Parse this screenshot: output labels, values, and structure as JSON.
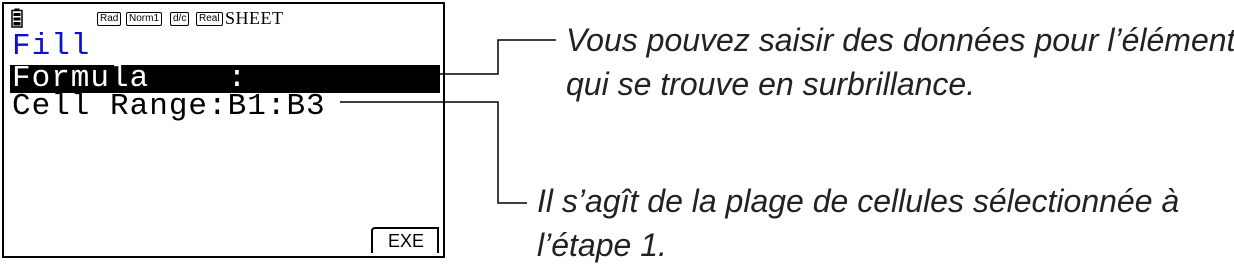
{
  "screen": {
    "status": {
      "badge_rad": "Rad",
      "badge_norm": "Norm1",
      "badge_dc": "d/c",
      "badge_real": "Real",
      "mode": "SHEET"
    },
    "title": "Fill",
    "formula_row": "Formula    :",
    "cell_range_row": "Cell Range:B1:B3",
    "softkey_exe": "EXE"
  },
  "annotations": {
    "highlighted_line1": "Vous pouvez saisir des données pour l’élément",
    "highlighted_line2": "qui se trouve en surbrillance.",
    "range_line1": "Il s’agît de la plage de cellules sélectionnée à",
    "range_line2": "l’étape 1."
  }
}
